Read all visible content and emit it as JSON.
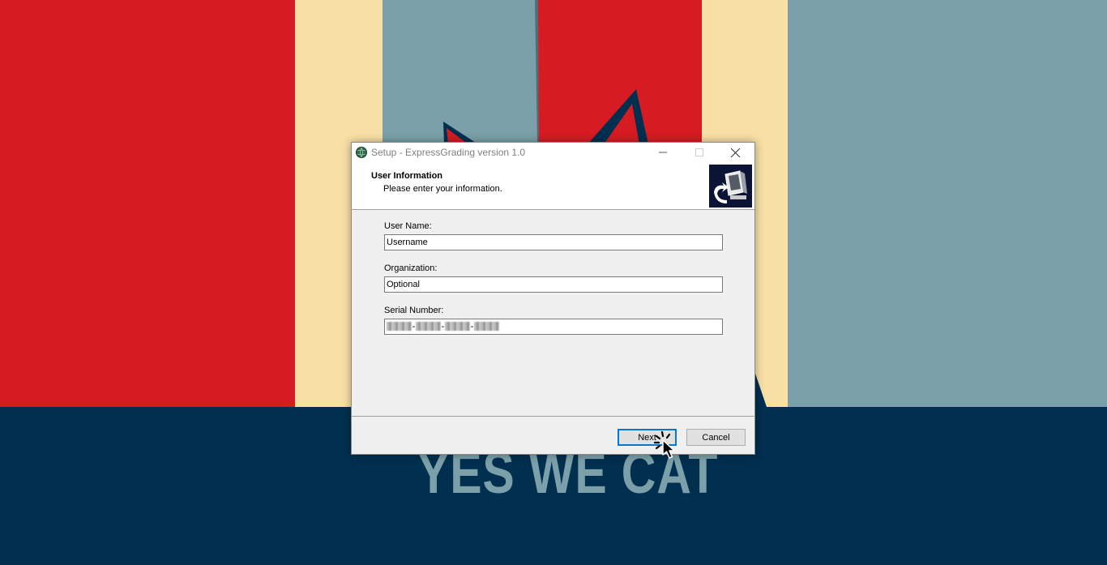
{
  "desktop": {
    "colors": {
      "red": "#d61b22",
      "cream": "#f7dfa6",
      "teal": "#7aa0a9",
      "navy": "#012f50"
    },
    "slogan": "YES WE CAT"
  },
  "window": {
    "title": "Setup - ExpressGrading version 1.0",
    "app_icon": "installer-globe-icon",
    "controls": {
      "minimize": "—",
      "maximize": "☐",
      "close": "✕"
    }
  },
  "header": {
    "title": "User Information",
    "subtitle": "Please enter your information.",
    "image": "setup-computer-icon"
  },
  "form": {
    "user_name_label": "User Name:",
    "user_name_value": "Username",
    "organization_label": "Organization:",
    "organization_value": "Optional",
    "serial_label": "Serial Number:",
    "serial_separator": "-"
  },
  "buttons": {
    "next": "Next",
    "cancel": "Cancel"
  }
}
